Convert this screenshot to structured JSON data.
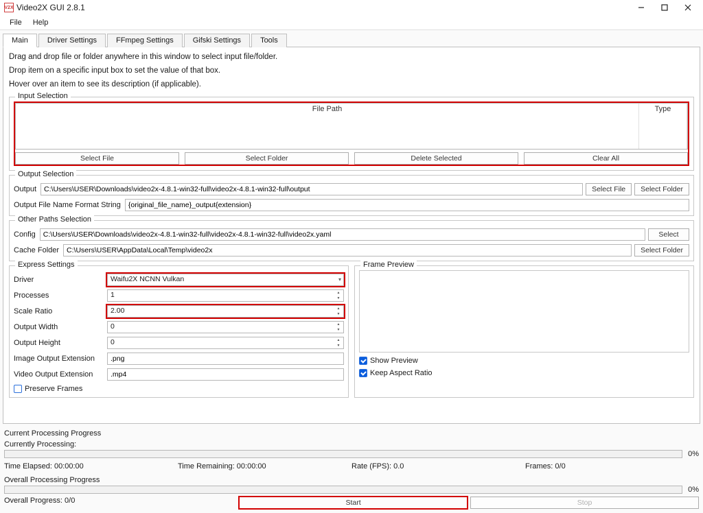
{
  "window": {
    "title": "Video2X GUI 2.8.1"
  },
  "menubar": {
    "file": "File",
    "help": "Help"
  },
  "tabs": {
    "main": "Main",
    "driver_settings": "Driver Settings",
    "ffmpeg_settings": "FFmpeg Settings",
    "gifski_settings": "Gifski Settings",
    "tools": "Tools"
  },
  "hints": {
    "line1": "Drag and drop file or folder anywhere in this window to select input file/folder.",
    "line2": "Drop item on a specific input box to set the value of that box.",
    "line3": "Hover over an item to see its description (if applicable)."
  },
  "input_selection": {
    "legend": "Input Selection",
    "col_filepath": "File Path",
    "col_type": "Type",
    "select_file": "Select File",
    "select_folder": "Select Folder",
    "delete_selected": "Delete Selected",
    "clear_all": "Clear All"
  },
  "output": {
    "legend": "Output Selection",
    "output_label": "Output",
    "output_value": "C:\\Users\\USER\\Downloads\\video2x-4.8.1-win32-full\\video2x-4.8.1-win32-full\\output",
    "select_file": "Select File",
    "select_folder": "Select Folder",
    "fmt_label": "Output File Name Format String",
    "fmt_value": "{original_file_name}_output{extension}"
  },
  "other_paths": {
    "legend": "Other Paths Selection",
    "config_label": "Config",
    "config_value": "C:\\Users\\USER\\Downloads\\video2x-4.8.1-win32-full\\video2x-4.8.1-win32-full\\video2x.yaml",
    "select": "Select",
    "cache_label": "Cache Folder",
    "cache_value": "C:\\Users\\USER\\AppData\\Local\\Temp\\video2x",
    "select_folder": "Select Folder"
  },
  "express": {
    "legend": "Express Settings",
    "driver_label": "Driver",
    "driver_value": "Waifu2X NCNN Vulkan",
    "processes_label": "Processes",
    "processes_value": "1",
    "scale_label": "Scale Ratio",
    "scale_value": "2.00",
    "width_label": "Output Width",
    "width_value": "0",
    "height_label": "Output Height",
    "height_value": "0",
    "imgext_label": "Image Output Extension",
    "imgext_value": ".png",
    "vidext_label": "Video Output Extension",
    "vidext_value": ".mp4",
    "preserve_label": "Preserve Frames"
  },
  "preview": {
    "legend": "Frame Preview",
    "show_preview": "Show Preview",
    "keep_aspect": "Keep Aspect Ratio"
  },
  "progress": {
    "current_title": "Current Processing Progress",
    "currently": "Currently Processing:",
    "pct": "0%",
    "time_elapsed": "Time Elapsed: 00:00:00",
    "time_remaining": "Time Remaining: 00:00:00",
    "rate": "Rate (FPS): 0.0",
    "frames": "Frames: 0/0",
    "overall_title": "Overall Processing Progress",
    "overall_pct": "0%",
    "overall_progress": "Overall Progress: 0/0",
    "start": "Start",
    "stop": "Stop"
  }
}
